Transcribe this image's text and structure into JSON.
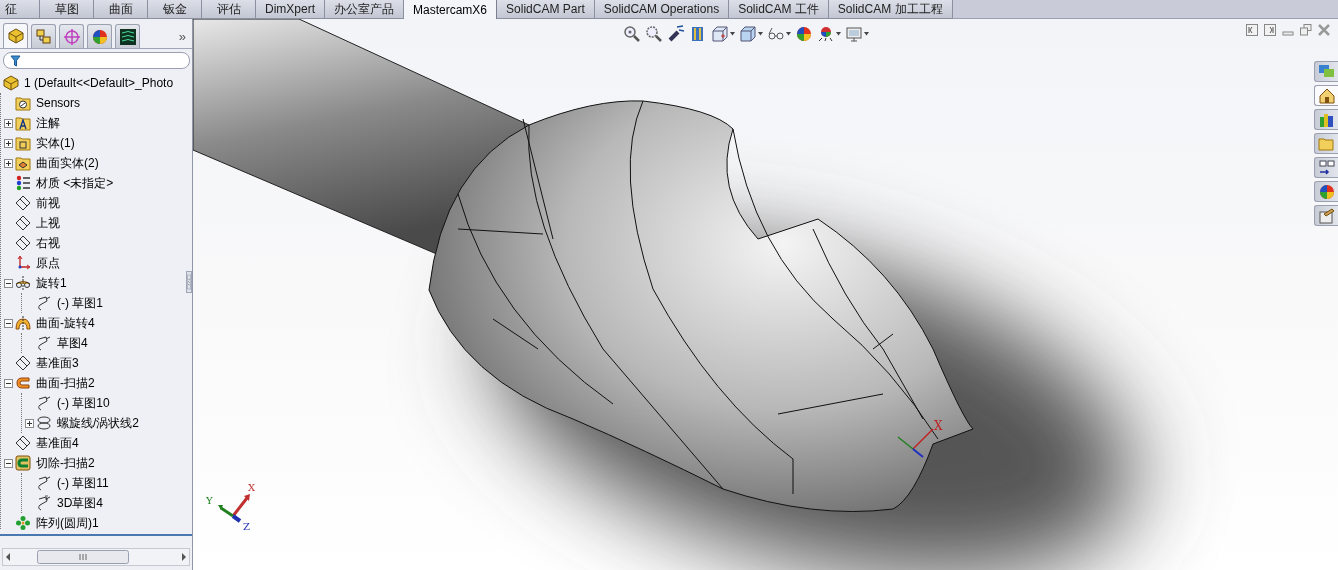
{
  "command_tabs": [
    {
      "label": "征",
      "selected": false
    },
    {
      "label": "草图",
      "selected": false
    },
    {
      "label": "曲面",
      "selected": false
    },
    {
      "label": "钣金",
      "selected": false
    },
    {
      "label": "评估",
      "selected": false
    },
    {
      "label": "DimXpert",
      "selected": false
    },
    {
      "label": "办公室产品",
      "selected": false
    },
    {
      "label": "MastercamX6",
      "selected": true
    },
    {
      "label": "SolidCAM Part",
      "selected": false
    },
    {
      "label": "SolidCAM Operations",
      "selected": false
    },
    {
      "label": "SolidCAM 工件",
      "selected": false
    },
    {
      "label": "SolidCAM 加工工程",
      "selected": false
    }
  ],
  "panel_tabs": [
    {
      "kind": "feature-tree",
      "selected": true
    },
    {
      "kind": "property",
      "selected": false
    },
    {
      "kind": "config",
      "selected": false
    },
    {
      "kind": "appearance",
      "selected": false
    },
    {
      "kind": "cam",
      "selected": false
    }
  ],
  "panel_more": "»",
  "tree": [
    {
      "label": "1  (Default<<Default>_Photo",
      "kind": "part",
      "children": [
        {
          "label": "Sensors",
          "kind": "sensor"
        },
        {
          "label": "注解",
          "kind": "annotation",
          "expanded": false
        },
        {
          "label": "实体(1)",
          "kind": "solid",
          "expanded": false
        },
        {
          "label": "曲面实体(2)",
          "kind": "surface-body",
          "expanded": false
        },
        {
          "label": "材质 <未指定>",
          "kind": "material"
        },
        {
          "label": "前视",
          "kind": "plane"
        },
        {
          "label": "上视",
          "kind": "plane"
        },
        {
          "label": "右视",
          "kind": "plane"
        },
        {
          "label": "原点",
          "kind": "origin"
        },
        {
          "label": "旋转1",
          "kind": "revolve",
          "expanded": true,
          "children": [
            {
              "label": "(-) 草图1",
              "kind": "sketch"
            }
          ]
        },
        {
          "label": "曲面-旋转4",
          "kind": "surface-revolve",
          "expanded": true,
          "children": [
            {
              "label": "草图4",
              "kind": "sketch"
            }
          ]
        },
        {
          "label": "基准面3",
          "kind": "plane"
        },
        {
          "label": "曲面-扫描2",
          "kind": "sweep",
          "expanded": true,
          "children": [
            {
              "label": "(-) 草图10",
              "kind": "sketch"
            },
            {
              "label": "螺旋线/涡状线2",
              "kind": "helix",
              "expanded": false
            }
          ]
        },
        {
          "label": "基准面4",
          "kind": "plane"
        },
        {
          "label": "切除-扫描2",
          "kind": "cut-sweep",
          "expanded": true,
          "children": [
            {
              "label": "(-) 草图11",
              "kind": "sketch"
            },
            {
              "label": "3D草图4",
              "kind": "sketch3d"
            }
          ]
        },
        {
          "label": "阵列(圆周)1",
          "kind": "pattern"
        }
      ]
    }
  ],
  "view_toolbar": [
    {
      "kind": "zoom-fit",
      "dropdown": false
    },
    {
      "kind": "zoom-area",
      "dropdown": false
    },
    {
      "kind": "previous-view",
      "dropdown": false
    },
    {
      "kind": "section-view",
      "dropdown": false
    },
    {
      "kind": "view-orientation",
      "dropdown": true
    },
    {
      "kind": "display-style",
      "dropdown": true
    },
    {
      "kind": "hide-show",
      "dropdown": true
    },
    {
      "kind": "appearance",
      "dropdown": false
    },
    {
      "kind": "scene",
      "dropdown": true
    },
    {
      "kind": "view-settings",
      "dropdown": true
    }
  ],
  "window_controls": [
    {
      "kind": "tile-left"
    },
    {
      "kind": "tile-right"
    },
    {
      "kind": "minimize"
    },
    {
      "kind": "restore"
    },
    {
      "kind": "close"
    }
  ],
  "task_pane": [
    {
      "kind": "forum",
      "selected": false
    },
    {
      "kind": "home",
      "selected": true
    },
    {
      "kind": "library",
      "selected": false
    },
    {
      "kind": "explorer",
      "selected": false
    },
    {
      "kind": "palette",
      "selected": false
    },
    {
      "kind": "appearance",
      "selected": false
    },
    {
      "kind": "properties",
      "selected": false
    }
  ],
  "model_triad": {
    "x": "X"
  },
  "triad": {
    "x": "X",
    "y": "Y",
    "z": "Z"
  }
}
